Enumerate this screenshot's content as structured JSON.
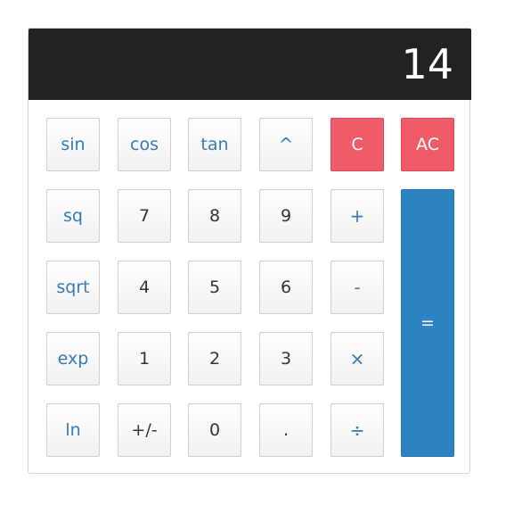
{
  "display": {
    "value": "14"
  },
  "keys": {
    "sin": "sin",
    "cos": "cos",
    "tan": "tan",
    "pow": "^",
    "clear": "C",
    "all_clear": "AC",
    "sq": "sq",
    "seven": "7",
    "eight": "8",
    "nine": "9",
    "plus": "+",
    "sqrt": "sqrt",
    "four": "4",
    "five": "5",
    "six": "6",
    "minus": "-",
    "exp": "exp",
    "one": "1",
    "two": "2",
    "three": "3",
    "multiply": "×",
    "ln": "ln",
    "negate": "+/-",
    "zero": "0",
    "decimal": ".",
    "divide": "÷",
    "equals": "="
  },
  "colors": {
    "display_bg": "#222222",
    "clear_key": "#ef5b67",
    "equals_key": "#2d83c0",
    "function_text": "#337ab7"
  }
}
